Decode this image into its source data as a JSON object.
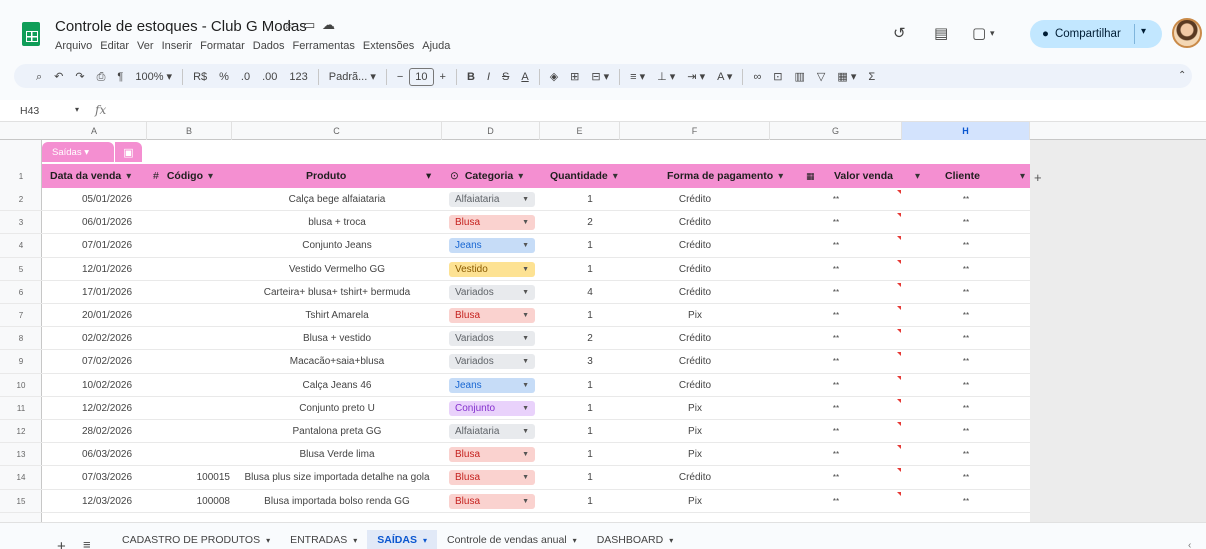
{
  "doc": {
    "title": "Controle de estoques - Club G Modas",
    "menu": [
      "Arquivo",
      "Editar",
      "Ver",
      "Inserir",
      "Formatar",
      "Dados",
      "Ferramentas",
      "Extensões",
      "Ajuda"
    ]
  },
  "share": {
    "label": "Compartilhar"
  },
  "toolbar": {
    "zoom": "100%",
    "currency": "R$",
    "percent": "%",
    "dec_less": ".0",
    "dec_more": ".00",
    "num_format": "123",
    "font": "Padrã...",
    "font_size": "10",
    "bold": "B",
    "italic": "I",
    "strike": "S",
    "textcolor": "A"
  },
  "formula_bar": {
    "cell_ref": "H43",
    "fx": "fx"
  },
  "columns": [
    "A",
    "B",
    "C",
    "D",
    "E",
    "F",
    "G",
    "H"
  ],
  "table": {
    "name": "Saídas",
    "headers": {
      "date": "Data da venda",
      "code": "Código",
      "code_prefix": "#",
      "product": "Produto",
      "category": "Categoria",
      "qty": "Quantidade",
      "payment": "Forma de pagamento",
      "value": "Valor venda",
      "client": "Cliente"
    },
    "rows": [
      {
        "n": "2",
        "date": "05/01/2026",
        "code": "",
        "product": "Calça bege alfaiataria",
        "category": "Alfaiataria",
        "qty": "1",
        "payment": "Crédito",
        "value": "**",
        "client": "**"
      },
      {
        "n": "3",
        "date": "06/01/2026",
        "code": "",
        "product": "blusa + troca",
        "category": "Blusa",
        "qty": "2",
        "payment": "Crédito",
        "value": "**",
        "client": "**"
      },
      {
        "n": "4",
        "date": "07/01/2026",
        "code": "",
        "product": "Conjunto Jeans",
        "category": "Jeans",
        "qty": "1",
        "payment": "Crédito",
        "value": "**",
        "client": "**"
      },
      {
        "n": "5",
        "date": "12/01/2026",
        "code": "",
        "product": "Vestido Vermelho GG",
        "category": "Vestido",
        "qty": "1",
        "payment": "Crédito",
        "value": "**",
        "client": "**"
      },
      {
        "n": "6",
        "date": "17/01/2026",
        "code": "",
        "product": "Carteira+ blusa+ tshirt+ bermuda",
        "category": "Variados",
        "qty": "4",
        "payment": "Crédito",
        "value": "**",
        "client": "**"
      },
      {
        "n": "7",
        "date": "20/01/2026",
        "code": "",
        "product": "Tshirt Amarela",
        "category": "Blusa",
        "qty": "1",
        "payment": "Pix",
        "value": "**",
        "client": "**"
      },
      {
        "n": "8",
        "date": "02/02/2026",
        "code": "",
        "product": "Blusa + vestido",
        "category": "Variados",
        "qty": "2",
        "payment": "Crédito",
        "value": "**",
        "client": "**"
      },
      {
        "n": "9",
        "date": "07/02/2026",
        "code": "",
        "product": "Macacão+saia+blusa",
        "category": "Variados",
        "qty": "3",
        "payment": "Crédito",
        "value": "**",
        "client": "**"
      },
      {
        "n": "10",
        "date": "10/02/2026",
        "code": "",
        "product": "Calça Jeans 46",
        "category": "Jeans",
        "qty": "1",
        "payment": "Crédito",
        "value": "**",
        "client": "**"
      },
      {
        "n": "11",
        "date": "12/02/2026",
        "code": "",
        "product": "Conjunto preto U",
        "category": "Conjunto",
        "qty": "1",
        "payment": "Pix",
        "value": "**",
        "client": "**"
      },
      {
        "n": "12",
        "date": "28/02/2026",
        "code": "",
        "product": "Pantalona preta GG",
        "category": "Alfaiataria",
        "qty": "1",
        "payment": "Pix",
        "value": "**",
        "client": "**"
      },
      {
        "n": "13",
        "date": "06/03/2026",
        "code": "",
        "product": "Blusa Verde lima",
        "category": "Blusa",
        "qty": "1",
        "payment": "Pix",
        "value": "**",
        "client": "**"
      },
      {
        "n": "14",
        "date": "07/03/2026",
        "code": "100015",
        "product": "Blusa plus size importada detalhe na gola",
        "category": "Blusa",
        "qty": "1",
        "payment": "Crédito",
        "value": "**",
        "client": "**"
      },
      {
        "n": "15",
        "date": "12/03/2026",
        "code": "100008",
        "product": "Blusa importada bolso renda GG",
        "category": "Blusa",
        "qty": "1",
        "payment": "Pix",
        "value": "**",
        "client": "**"
      }
    ]
  },
  "category_colors": {
    "Alfaiataria": {
      "bg": "#e8eaed",
      "fg": "#5f6368"
    },
    "Blusa": {
      "bg": "#fad2cf",
      "fg": "#c5221f"
    },
    "Jeans": {
      "bg": "#c6dcf7",
      "fg": "#1967d2"
    },
    "Vestido": {
      "bg": "#fde293",
      "fg": "#8a5a00"
    },
    "Variados": {
      "bg": "#e8eaed",
      "fg": "#5f6368"
    },
    "Conjunto": {
      "bg": "#e9d2fb",
      "fg": "#8430ce"
    }
  },
  "sheets": [
    {
      "label": "CADASTRO DE PRODUTOS",
      "active": false
    },
    {
      "label": "ENTRADAS",
      "active": false
    },
    {
      "label": "SAÍDAS",
      "active": true
    },
    {
      "label": "Controle de vendas anual",
      "active": false
    },
    {
      "label": "DASHBOARD",
      "active": false
    }
  ]
}
